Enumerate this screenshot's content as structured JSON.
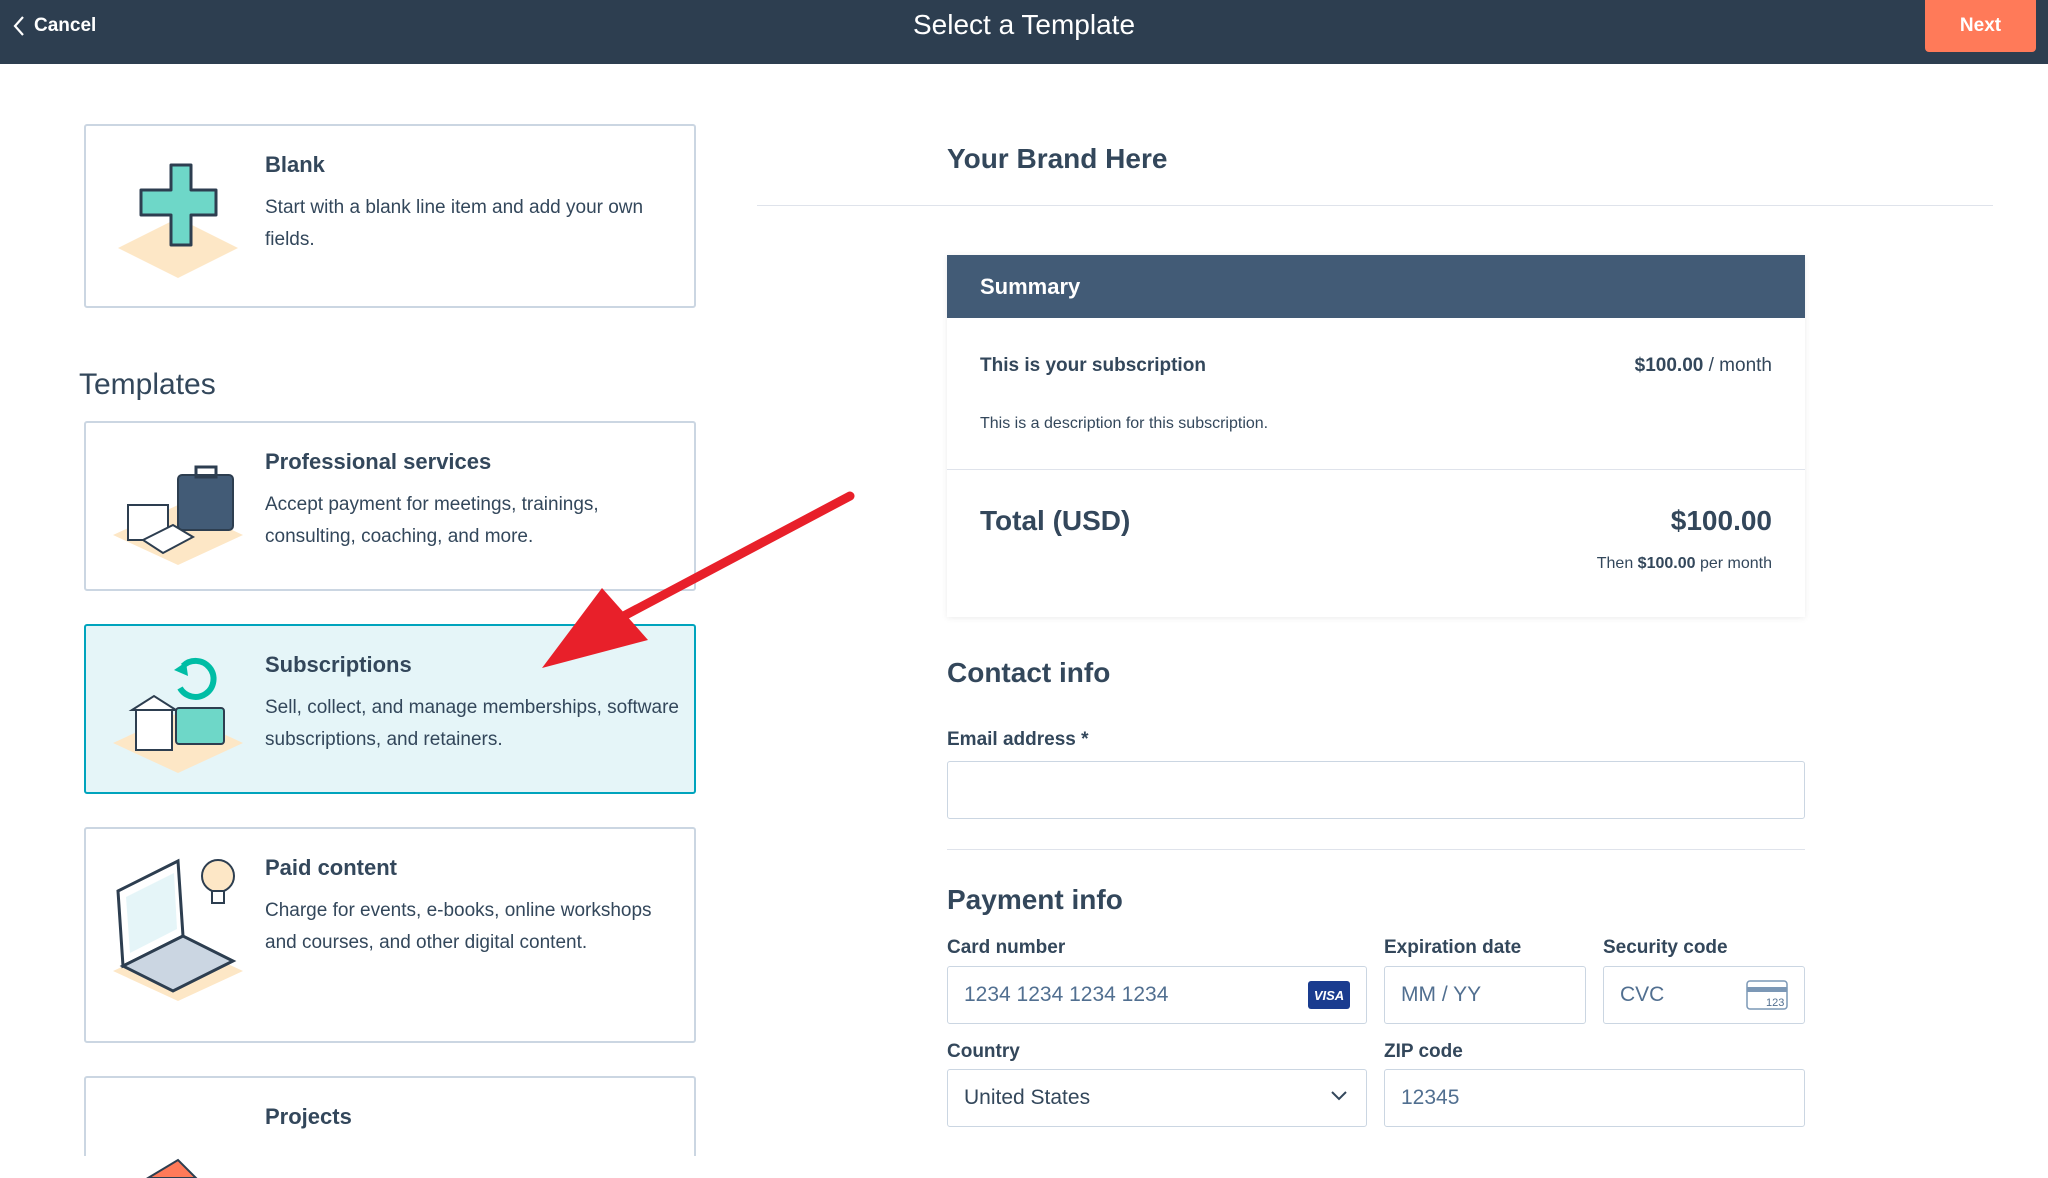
{
  "topbar": {
    "cancel_label": "Cancel",
    "title": "Select a Template",
    "next_label": "Next"
  },
  "blank_card": {
    "title": "Blank",
    "description": "Start with a blank line item and add your own fields."
  },
  "templates": {
    "heading": "Templates",
    "items": [
      {
        "title": "Professional services",
        "description": "Accept payment for meetings, trainings, consulting, coaching, and more."
      },
      {
        "title": "Subscriptions",
        "description": "Sell, collect, and manage memberships, software subscriptions, and retainers."
      },
      {
        "title": "Paid content",
        "description": "Charge for events, e-books, online workshops and courses, and other digital content."
      },
      {
        "title": "Projects",
        "description": ""
      }
    ]
  },
  "preview": {
    "brand": "Your Brand Here",
    "summary": {
      "header": "Summary",
      "subscription_title": "This is your subscription",
      "subscription_price": "$100.00",
      "subscription_period": " / month",
      "subscription_description": "This is a description for this subscription.",
      "total_label": "Total (USD)",
      "total_value": "$100.00",
      "then_prefix": "Then ",
      "then_amount": "$100.00",
      "then_suffix": " per month"
    },
    "contact": {
      "heading": "Contact info",
      "email_label": "Email address *",
      "email_value": ""
    },
    "payment": {
      "heading": "Payment info",
      "card_label": "Card number",
      "card_placeholder": "1234 1234 1234 1234",
      "card_brand": "VISA",
      "exp_label": "Expiration date",
      "exp_placeholder": "MM / YY",
      "cvc_label": "Security code",
      "cvc_placeholder": "CVC",
      "cvc_icon_text": "123",
      "country_label": "Country",
      "country_value": "United States",
      "zip_label": "ZIP code",
      "zip_placeholder": "12345"
    }
  },
  "colors": {
    "topbar": "#2d3e50",
    "accent": "#ff7a59",
    "summary_header": "#425b76",
    "selected_card": "#e5f5f8",
    "selected_border": "#00a4bd",
    "arrow": "#e8202a"
  }
}
